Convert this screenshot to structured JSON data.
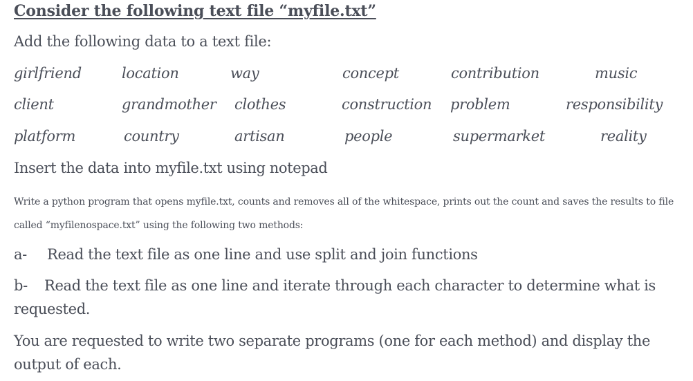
{
  "title": "Consider the following text file “myfile.txt”",
  "intro": "Add the following data to a text file:",
  "words": [
    [
      "girlfriend",
      "location",
      "way",
      "concept",
      "contribution",
      "music"
    ],
    [
      "client",
      "grandmother",
      "clothes",
      "construction",
      "problem",
      "responsibility"
    ],
    [
      "platform",
      "country",
      "artisan",
      "people",
      "supermarket",
      "reality"
    ]
  ],
  "insert_instruction": "Insert the data into myfile.txt using notepad",
  "task": {
    "line1": "Write a python program that opens myfile.txt, counts and removes all of the whitespace, prints out the count and saves the results to file",
    "line2": "called “myfilenospace.txt” using the following two methods:"
  },
  "methods": [
    {
      "prefix": "a-",
      "text": "Read the text file as one line and use split and join functions"
    },
    {
      "prefix": "b-",
      "text": "Read the text file as one line and iterate through each character to determine what is",
      "continuation": "requested."
    }
  ],
  "closing": {
    "line1": "You are requested to write two separate programs (one for each method) and display the",
    "line2": "output of each."
  },
  "colors": {
    "text": "#4a4e58",
    "background": "#ffffff"
  }
}
